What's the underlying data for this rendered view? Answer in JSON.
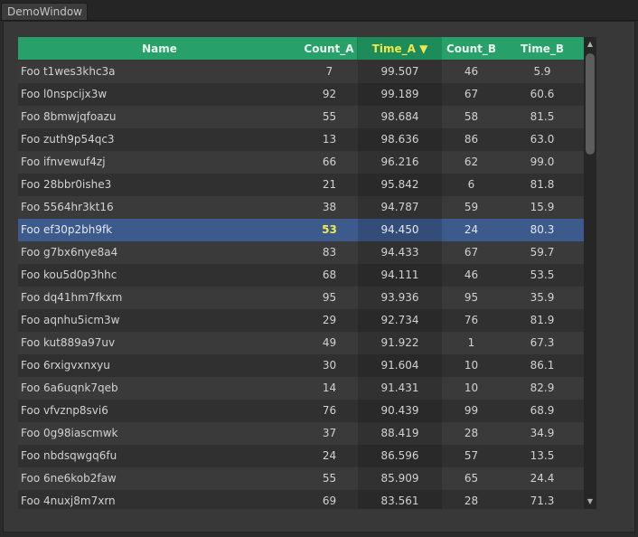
{
  "window": {
    "tab_title": "DemoWindow"
  },
  "table": {
    "columns": [
      {
        "label": "Name"
      },
      {
        "label": "Count_A"
      },
      {
        "label": "Time_A ▼",
        "sorted": true
      },
      {
        "label": "Count_B"
      },
      {
        "label": "Time_B"
      }
    ],
    "selected_index": 7,
    "rows": [
      {
        "name": "Foo t1wes3khc3a",
        "count_a": "7",
        "time_a": "99.507",
        "count_b": "46",
        "time_b": "5.9"
      },
      {
        "name": "Foo l0nspcijx3w",
        "count_a": "92",
        "time_a": "99.189",
        "count_b": "67",
        "time_b": "60.6"
      },
      {
        "name": "Foo 8bmwjqfoazu",
        "count_a": "55",
        "time_a": "98.684",
        "count_b": "58",
        "time_b": "81.5"
      },
      {
        "name": "Foo zuth9p54qc3",
        "count_a": "13",
        "time_a": "98.636",
        "count_b": "86",
        "time_b": "63.0"
      },
      {
        "name": "Foo ifnvewuf4zj",
        "count_a": "66",
        "time_a": "96.216",
        "count_b": "62",
        "time_b": "99.0"
      },
      {
        "name": "Foo 28bbr0ishe3",
        "count_a": "21",
        "time_a": "95.842",
        "count_b": "6",
        "time_b": "81.8"
      },
      {
        "name": "Foo 5564hr3kt16",
        "count_a": "38",
        "time_a": "94.787",
        "count_b": "59",
        "time_b": "15.9"
      },
      {
        "name": "Foo ef30p2bh9fk",
        "count_a": "53",
        "time_a": "94.450",
        "count_b": "24",
        "time_b": "80.3"
      },
      {
        "name": "Foo g7bx6nye8a4",
        "count_a": "83",
        "time_a": "94.433",
        "count_b": "67",
        "time_b": "59.7"
      },
      {
        "name": "Foo kou5d0p3hhc",
        "count_a": "68",
        "time_a": "94.111",
        "count_b": "46",
        "time_b": "53.5"
      },
      {
        "name": "Foo dq41hm7fkxm",
        "count_a": "95",
        "time_a": "93.936",
        "count_b": "95",
        "time_b": "35.9"
      },
      {
        "name": "Foo aqnhu5icm3w",
        "count_a": "29",
        "time_a": "92.734",
        "count_b": "76",
        "time_b": "81.9"
      },
      {
        "name": "Foo kut889a97uv",
        "count_a": "49",
        "time_a": "91.922",
        "count_b": "1",
        "time_b": "67.3"
      },
      {
        "name": "Foo 6rxigvxnxyu",
        "count_a": "30",
        "time_a": "91.604",
        "count_b": "10",
        "time_b": "86.1"
      },
      {
        "name": "Foo 6a6uqnk7qeb",
        "count_a": "14",
        "time_a": "91.431",
        "count_b": "10",
        "time_b": "82.9"
      },
      {
        "name": "Foo vfvznp8svi6",
        "count_a": "76",
        "time_a": "90.439",
        "count_b": "99",
        "time_b": "68.9"
      },
      {
        "name": "Foo 0g98iascmwk",
        "count_a": "37",
        "time_a": "88.419",
        "count_b": "28",
        "time_b": "34.9"
      },
      {
        "name": "Foo nbdsqwgq6fu",
        "count_a": "24",
        "time_a": "86.596",
        "count_b": "57",
        "time_b": "13.5"
      },
      {
        "name": "Foo 6ne6kob2faw",
        "count_a": "55",
        "time_a": "85.909",
        "count_b": "65",
        "time_b": "24.4"
      },
      {
        "name": "Foo 4nuxj8m7xrn",
        "count_a": "69",
        "time_a": "83.561",
        "count_b": "28",
        "time_b": "71.3"
      }
    ]
  },
  "scrollbar": {
    "up_icon": "▲",
    "down_icon": "▼"
  }
}
